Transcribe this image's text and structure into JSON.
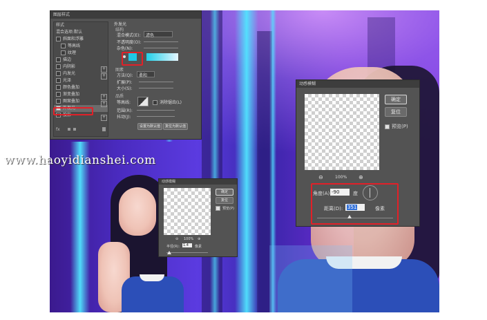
{
  "watermark": "www.haoyidianshei.com",
  "layer_style": {
    "title": "图层样式",
    "styles_header": "样式",
    "blend_options": "混合选项:默认",
    "items": [
      "斜面和浮雕",
      "等高线",
      "纹理",
      "描边",
      "内阴影",
      "内发光",
      "光泽",
      "颜色叠加",
      "渐变叠加",
      "图案叠加",
      "外发光",
      "投影"
    ],
    "section_title": "外发光",
    "structure": "结构",
    "blend_mode_label": "混合模式(E):",
    "blend_mode_value": "滤色",
    "opacity_label": "不透明度(O):",
    "noise_label": "杂色(N):",
    "elements": "图素",
    "method_label": "方法(Q):",
    "method_value": "柔和",
    "spread_label": "扩展(P):",
    "size_label": "大小(S):",
    "quality": "品质",
    "contour_label": "等高线:",
    "antialias_label": "消除锯齿(L)",
    "range_label": "范围(R):",
    "jitter_label": "抖动(J):",
    "make_default": "设置为默认值",
    "reset_default": "复位为默认值",
    "fx_icon": "fx-icon",
    "glow_colors": {
      "solid": "#1ec8e6",
      "gradient_from": "#20d0e8",
      "gradient_to": "#e6f6ff"
    }
  },
  "motion_blur_large": {
    "title": "动感模糊",
    "ok": "确定",
    "reset": "复位",
    "preview_label": "预览(P)",
    "zoom": "100%",
    "zoom_out_icon": "zoom-out-icon",
    "zoom_in_icon": "zoom-in-icon",
    "angle_label": "角度(A):",
    "angle_value": "-90",
    "angle_unit": "度",
    "distance_label": "距离(D):",
    "distance_value": "351",
    "distance_unit": "像素"
  },
  "motion_blur_small": {
    "title": "动感模糊",
    "ok": "确定",
    "reset": "复位",
    "preview_label": "预览(P)",
    "zoom": "100%",
    "distance_label": "半径(R):",
    "distance_value": "1.4",
    "distance_unit": "像素"
  },
  "colors": {
    "highlight_box": "#e22028",
    "panel": "#535353",
    "accent_glow": "#50e6ff"
  }
}
